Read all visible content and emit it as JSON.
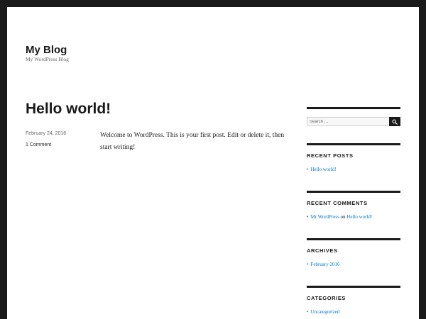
{
  "site": {
    "title": "My Blog",
    "description": "My WordPress Blog"
  },
  "post": {
    "title": "Hello world!",
    "date": "February 24, 2016",
    "comments": "1 Comment",
    "content": "Welcome to WordPress. This is your first post. Edit or delete it, then start writing!"
  },
  "sidebar": {
    "search": {
      "placeholder": "Search …"
    },
    "recent_posts": {
      "title": "RECENT POSTS",
      "items": [
        {
          "label": "Hello world!"
        }
      ]
    },
    "recent_comments": {
      "title": "RECENT COMMENTS",
      "items": [
        {
          "author": "Mr WordPress",
          "connector": "on",
          "post": "Hello world!"
        }
      ]
    },
    "archives": {
      "title": "ARCHIVES",
      "items": [
        {
          "label": "February 2016"
        }
      ]
    },
    "categories": {
      "title": "CATEGORIES",
      "items": [
        {
          "label": "Uncategorized"
        }
      ]
    }
  },
  "colors": {
    "link": "#007acc",
    "text": "#1a1a1a",
    "muted": "#686868",
    "frame": "#1a1a1a",
    "background": "#ffffff"
  },
  "icons": {
    "bullet": "•",
    "search": "search-icon"
  }
}
